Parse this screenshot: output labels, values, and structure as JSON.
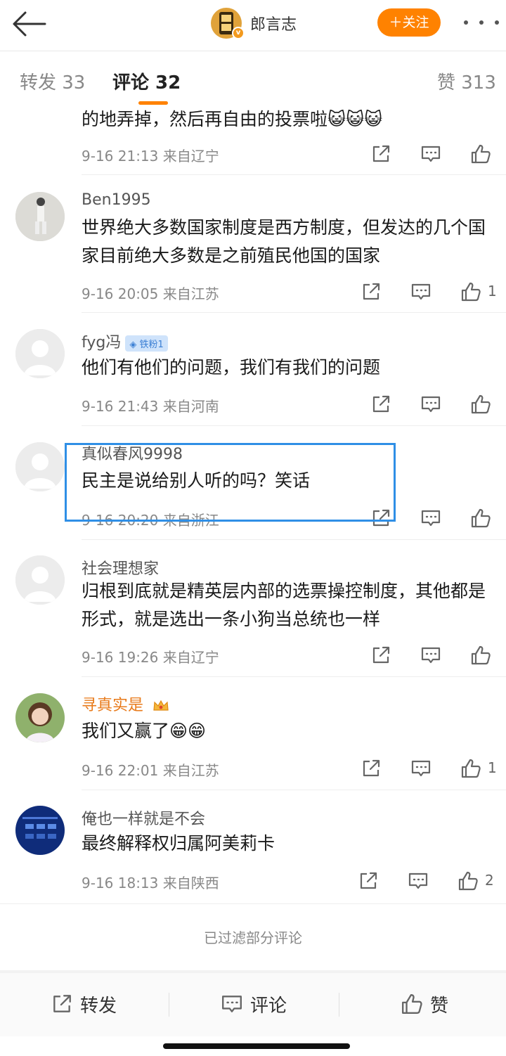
{
  "header": {
    "back_label": "",
    "author_name": "郎言志",
    "follow_label": "＋关注"
  },
  "tabs": [
    {
      "label": "转发 33"
    },
    {
      "label": "评论 32"
    },
    {
      "label": "赞 313"
    }
  ],
  "comments": [
    {
      "name": "",
      "text": "的地弄掉，然后再自由的投票啦😺😺😺",
      "meta": "9-16 21:13 来自辽宁",
      "likes": ""
    },
    {
      "name": "Ben1995",
      "text": "世界绝大多数国家制度是西方制度，但发达的几个国家目前绝大多数是之前殖民他国的国家",
      "meta": "9-16 20:05 来自江苏",
      "likes": "1"
    },
    {
      "name": "fyg冯",
      "badge": "◈ 铁粉1",
      "text": "他们有他们的问题，我们有我们的问题",
      "meta": "9-16 21:43 来自河南",
      "likes": ""
    },
    {
      "name": "真似春风9998",
      "text": "民主是说给别人听的吗？笑话",
      "meta": "9-16 20:20 来自浙江",
      "likes": ""
    },
    {
      "name": "社会理想家",
      "text": "归根到底就是精英层内部的选票操控制度，其他都是形式，就是选出一条小狗当总统也一样",
      "meta": "9-16 19:26 来自辽宁",
      "likes": ""
    },
    {
      "name": "寻真实是",
      "text": "我们又赢了😁😁",
      "meta": "9-16 22:01 来自江苏",
      "likes": "1"
    },
    {
      "name": "俺也一样就是不会",
      "text": "最终解释权归属阿美莉卡",
      "meta": "9-16 18:13 来自陕西",
      "likes": "2"
    }
  ],
  "filtered_note": "已过滤部分评论",
  "bottom_bar": {
    "repost": "转发",
    "comment": "评论",
    "like": "赞"
  },
  "colors": {
    "accent": "#ff8200",
    "highlight": "#2f8fe6"
  }
}
